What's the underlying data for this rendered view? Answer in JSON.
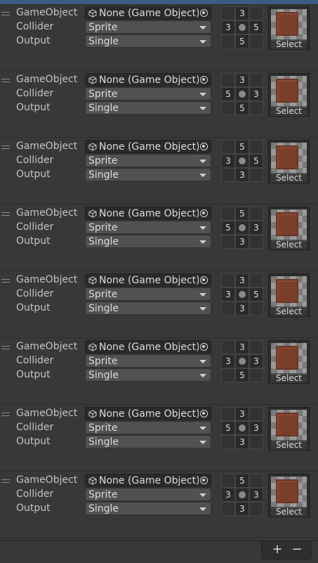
{
  "labels": {
    "gameobject": "GameObject",
    "collider": "Collider",
    "output": "Output",
    "select": "Select"
  },
  "rules": [
    {
      "gameobject": "None (Game Object)",
      "collider": "Sprite",
      "output": "Single",
      "grid": [
        "",
        "3",
        "",
        "3",
        "•",
        "5",
        "",
        "5",
        ""
      ]
    },
    {
      "gameobject": "None (Game Object)",
      "collider": "Sprite",
      "output": "Single",
      "grid": [
        "",
        "3",
        "",
        "5",
        "•",
        "3",
        "",
        "5",
        ""
      ]
    },
    {
      "gameobject": "None (Game Object)",
      "collider": "Sprite",
      "output": "Single",
      "grid": [
        "",
        "5",
        "",
        "3",
        "•",
        "5",
        "",
        "3",
        ""
      ]
    },
    {
      "gameobject": "None (Game Object)",
      "collider": "Sprite",
      "output": "Single",
      "grid": [
        "",
        "5",
        "",
        "5",
        "•",
        "3",
        "",
        "3",
        ""
      ]
    },
    {
      "gameobject": "None (Game Object)",
      "collider": "Sprite",
      "output": "Single",
      "grid": [
        "",
        "3",
        "",
        "3",
        "•",
        "5",
        "",
        "3",
        ""
      ]
    },
    {
      "gameobject": "None (Game Object)",
      "collider": "Sprite",
      "output": "Single",
      "grid": [
        "",
        "3",
        "",
        "3",
        "•",
        "3",
        "",
        "5",
        ""
      ]
    },
    {
      "gameobject": "None (Game Object)",
      "collider": "Sprite",
      "output": "Single",
      "grid": [
        "",
        "3",
        "",
        "5",
        "•",
        "3",
        "",
        "3",
        ""
      ]
    },
    {
      "gameobject": "None (Game Object)",
      "collider": "Sprite",
      "output": "Single",
      "grid": [
        "",
        "5",
        "",
        "3",
        "•",
        "3",
        "",
        "3",
        ""
      ]
    }
  ],
  "footer": {
    "add": "+",
    "remove": "−"
  },
  "icons": {
    "drag": "drag-handle-icon",
    "object": "cube-icon",
    "picker": "object-picker-icon",
    "dropdown": "chevron-down-icon"
  },
  "colors": {
    "background": "#383838",
    "field": "#515151",
    "object_field": "#2a2a2a",
    "accent": "#3c5b86",
    "tile": "#7a3f2a"
  }
}
